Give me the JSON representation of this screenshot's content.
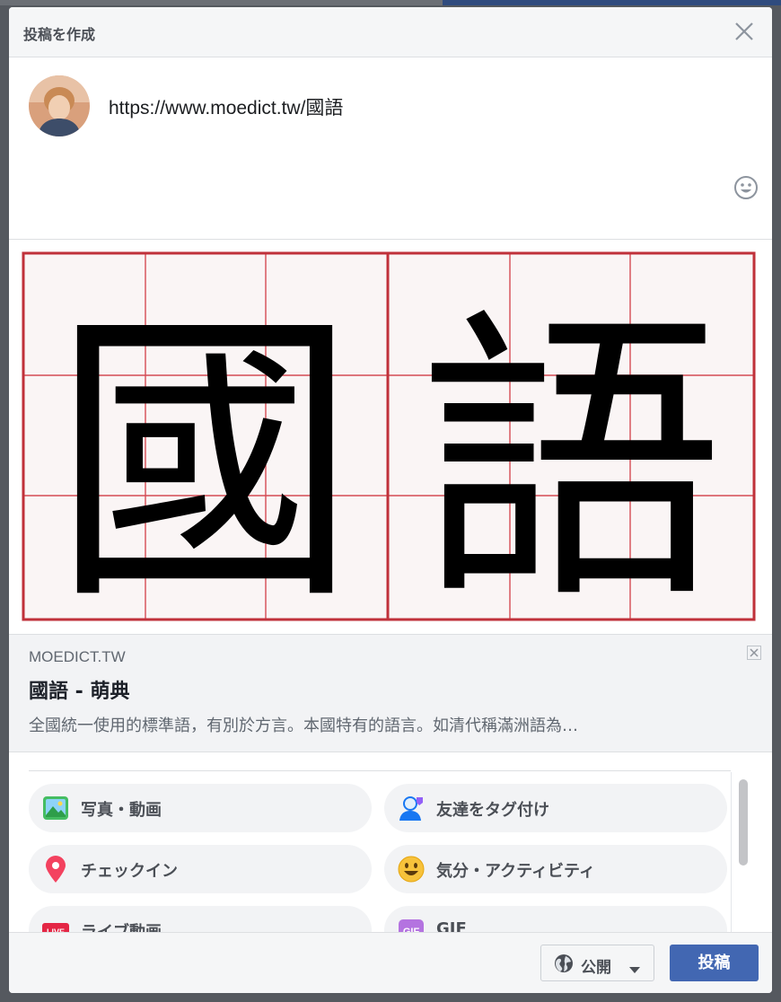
{
  "dialog": {
    "title": "投稿を作成",
    "close_icon": "close-icon"
  },
  "composer": {
    "text": "https://www.moedict.tw/國語",
    "emoji_icon": "smiley-icon"
  },
  "preview": {
    "characters": [
      "國",
      "語"
    ],
    "grid_color": "#c0313a",
    "background_color": "#faf5f5"
  },
  "link_card": {
    "domain": "MOEDICT.TW",
    "title": "國語 - 萌典",
    "description": "全國統一使用的標準語，有別於方言。本國特有的語言。如清代稱滿洲語為…"
  },
  "options": [
    {
      "label": "写真・動画",
      "icon": "photo-icon"
    },
    {
      "label": "友達をタグ付け",
      "icon": "tag-friends-icon"
    },
    {
      "label": "チェックイン",
      "icon": "location-pin-icon"
    },
    {
      "label": "気分・アクティビティ",
      "icon": "feeling-icon"
    },
    {
      "label": "ライブ動画",
      "icon": "live-icon"
    },
    {
      "label": "GIF",
      "icon": "gif-icon"
    }
  ],
  "footer": {
    "privacy_label": "公開",
    "submit_label": "投稿"
  },
  "colors": {
    "accent": "#4267b2",
    "header_bg": "#f5f6f7",
    "card_bg": "#f2f3f5"
  }
}
